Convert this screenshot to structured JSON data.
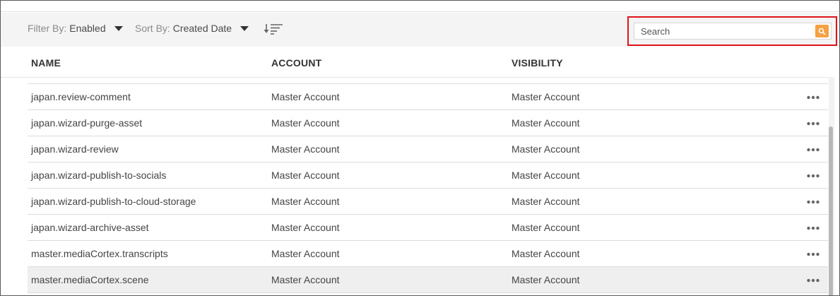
{
  "toolbar": {
    "filter_label": "Filter By:",
    "filter_value": "Enabled",
    "sort_label": "Sort By:",
    "sort_value": "Created Date",
    "sort_order_icon": "sort-descending-icon"
  },
  "search": {
    "placeholder": "Search",
    "value": "",
    "button_icon": "search-icon",
    "button_color": "#f5a142",
    "highlight_color": "#e0141a"
  },
  "table": {
    "columns": [
      "NAME",
      "ACCOUNT",
      "VISIBILITY"
    ],
    "rows": [
      {
        "name": "japan.review-comment",
        "account": "Master Account",
        "visibility": "Master Account"
      },
      {
        "name": "japan.wizard-purge-asset",
        "account": "Master Account",
        "visibility": "Master Account"
      },
      {
        "name": "japan.wizard-review",
        "account": "Master Account",
        "visibility": "Master Account"
      },
      {
        "name": "japan.wizard-publish-to-socials",
        "account": "Master Account",
        "visibility": "Master Account"
      },
      {
        "name": "japan.wizard-publish-to-cloud-storage",
        "account": "Master Account",
        "visibility": "Master Account"
      },
      {
        "name": "japan.wizard-archive-asset",
        "account": "Master Account",
        "visibility": "Master Account"
      },
      {
        "name": "master.mediaCortex.transcripts",
        "account": "Master Account",
        "visibility": "Master Account"
      },
      {
        "name": "master.mediaCortex.scene",
        "account": "Master Account",
        "visibility": "Master Account"
      }
    ],
    "selected_row": 7,
    "row_action_icon": "more-options-icon"
  }
}
